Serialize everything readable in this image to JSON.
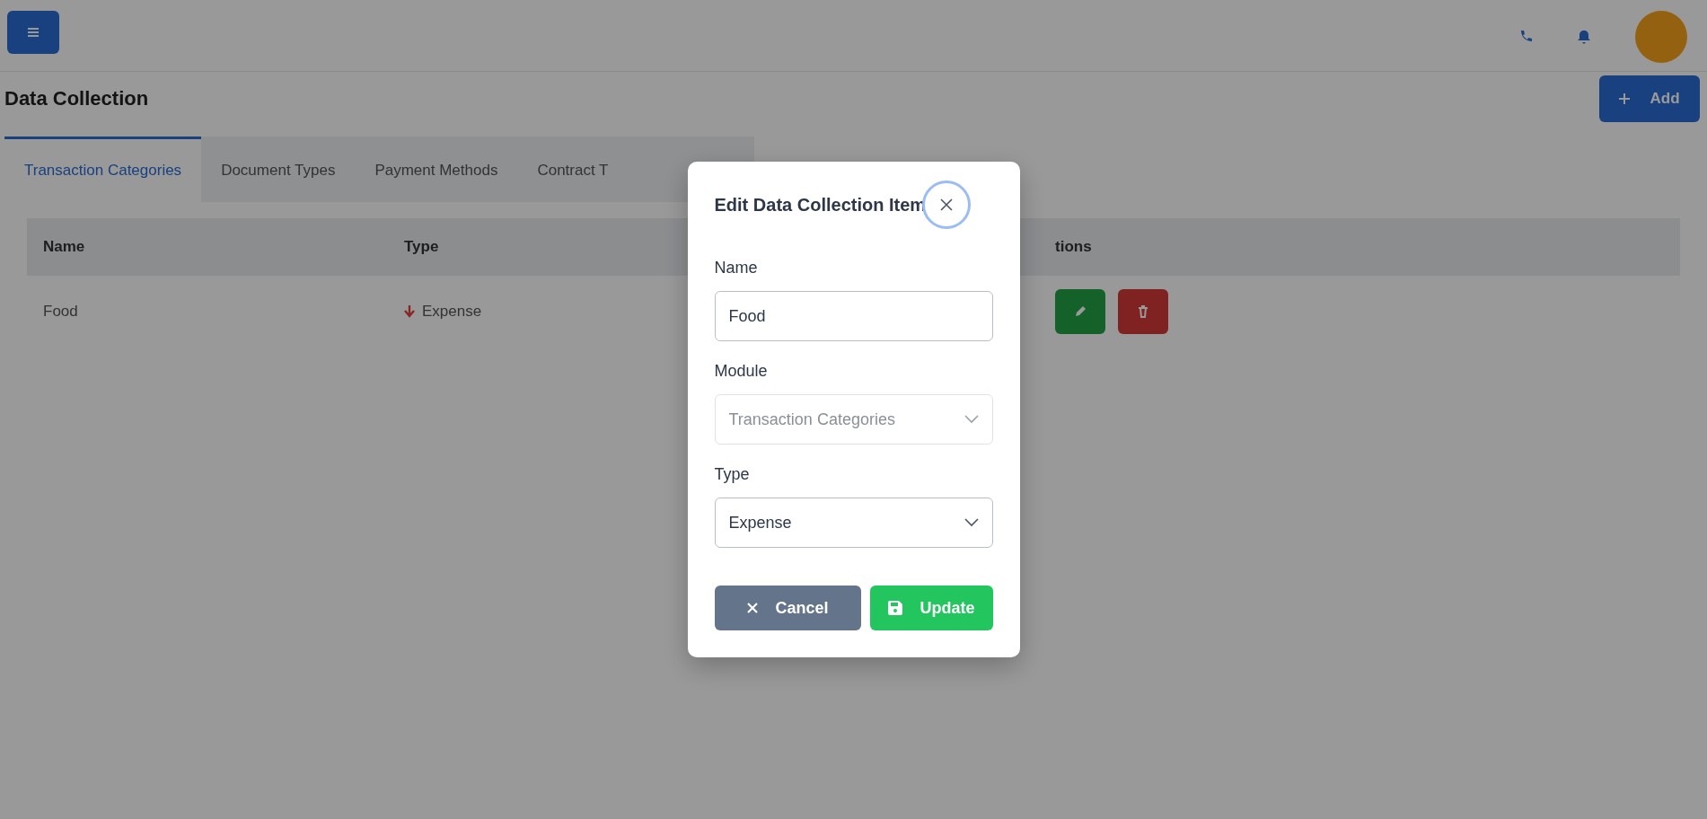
{
  "page": {
    "title": "Data Collection",
    "add_button": "Add"
  },
  "tabs": [
    {
      "label": "Transaction Categories",
      "selected": true
    },
    {
      "label": "Document Types",
      "selected": false
    },
    {
      "label": "Payment Methods",
      "selected": false
    },
    {
      "label": "Contract T",
      "selected": false
    }
  ],
  "table": {
    "columns": [
      "Name",
      "Type",
      "tions"
    ],
    "rows": [
      {
        "name": "Food",
        "type": "Expense"
      }
    ]
  },
  "modal": {
    "title": "Edit Data Collection Item",
    "fields": [
      {
        "label": "Name",
        "kind": "input",
        "value": "Food",
        "disabled": false
      },
      {
        "label": "Module",
        "kind": "select",
        "value": "Transaction Categories",
        "disabled": true
      },
      {
        "label": "Type",
        "kind": "select",
        "value": "Expense",
        "disabled": false
      }
    ],
    "buttons": [
      {
        "label": "Cancel",
        "kind": "cancel"
      },
      {
        "label": "Update",
        "kind": "save"
      }
    ]
  }
}
